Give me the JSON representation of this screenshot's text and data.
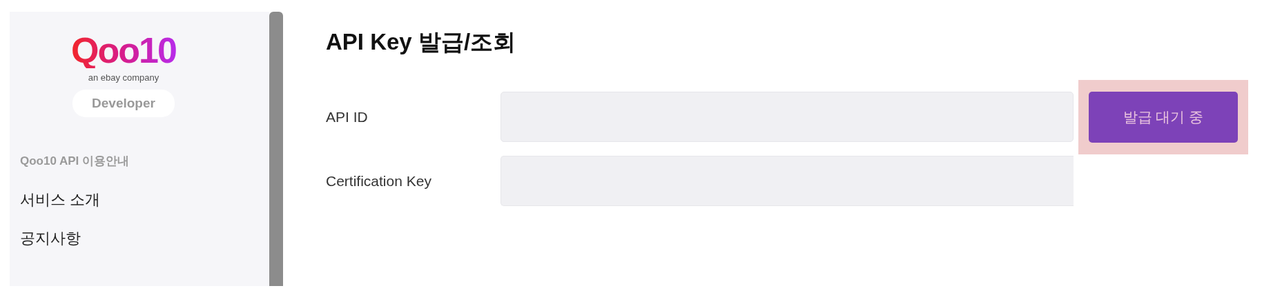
{
  "sidebar": {
    "logo": {
      "wordmark": "Qoo10",
      "tagline": "an ebay company"
    },
    "badge": "Developer",
    "section_heading": "Qoo10 API 이용안내",
    "items": [
      {
        "label": "서비스 소개"
      },
      {
        "label": "공지사항"
      }
    ]
  },
  "main": {
    "title": "API Key 발급/조회",
    "fields": [
      {
        "label": "API ID",
        "kind": "with-button",
        "button": {
          "label": "발급 대기 중",
          "highlighted": true
        }
      },
      {
        "label": "Certification Key",
        "kind": "plain"
      }
    ]
  }
}
